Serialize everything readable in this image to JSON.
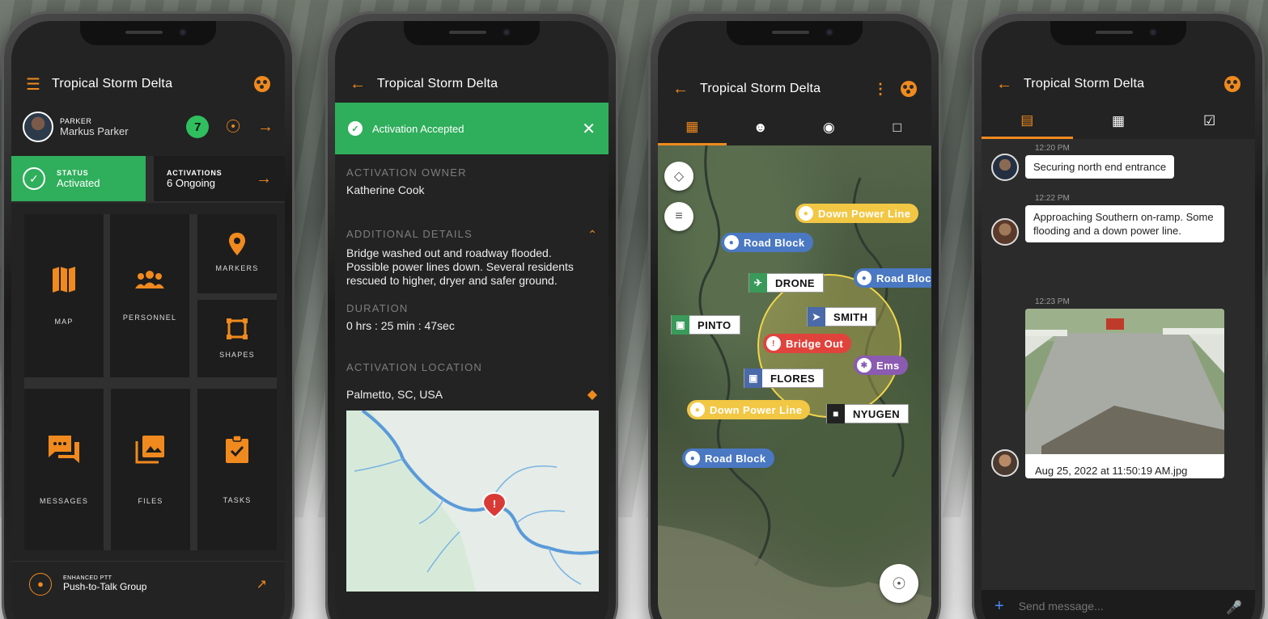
{
  "app": {
    "title": "Tropical Storm Delta",
    "colors": {
      "accent": "#f08a1e",
      "success": "#2fae5b",
      "dark_bg": "#232323"
    }
  },
  "dashboard": {
    "user_role": "PARKER",
    "user_name": "Markus Parker",
    "nav_badge": "7",
    "status": {
      "label": "STATUS",
      "value": "Activated"
    },
    "activations": {
      "label": "ACTIVATIONS",
      "value": "6 Ongoing"
    },
    "tiles": [
      {
        "label": "MAP",
        "icon": "map-icon"
      },
      {
        "label": "PERSONNEL",
        "icon": "people-icon"
      },
      {
        "label": "MARKERS",
        "icon": "marker-pin-icon"
      },
      {
        "label": "SHAPES",
        "icon": "shape-square-icon"
      },
      {
        "label": "MESSAGES",
        "icon": "chat-icon"
      },
      {
        "label": "FILES",
        "icon": "photo-library-icon"
      },
      {
        "label": "TASKS",
        "icon": "clipboard-check-icon"
      }
    ],
    "ptt": {
      "label": "ENHANCED PTT",
      "value": "Push-to-Talk Group"
    }
  },
  "activation": {
    "banner": "Activation Accepted",
    "owner_label": "ACTIVATION OWNER",
    "owner": "Katherine Cook",
    "details_label": "ADDITIONAL DETAILS",
    "details": "Bridge washed out and roadway flooded. Possible power lines down. Several residents rescued to higher, dryer and safer ground.",
    "duration_label": "DURATION",
    "duration": "0 hrs : 25 min : 47sec",
    "location_label": "ACTIVATION LOCATION",
    "location": "Palmetto, SC, USA"
  },
  "map_screen": {
    "markers": [
      {
        "label": "Down Power Line",
        "kind": "pill",
        "color": "#f2c744"
      },
      {
        "label": "Road Block",
        "kind": "pill",
        "color": "#4a78c2"
      },
      {
        "label": "DRONE",
        "kind": "box",
        "color": "#3a9a5a"
      },
      {
        "label": "Road Bloc",
        "kind": "pill",
        "color": "#4a78c2"
      },
      {
        "label": "PINTO",
        "kind": "box",
        "color": "#3a9a5a"
      },
      {
        "label": "SMITH",
        "kind": "box",
        "color": "#4a6aa8"
      },
      {
        "label": "Bridge Out",
        "kind": "pill",
        "color": "#e0433c"
      },
      {
        "label": "Ems",
        "kind": "pill",
        "color": "#8a5bb0"
      },
      {
        "label": "FLORES",
        "kind": "box",
        "color": "#4a6aa8"
      },
      {
        "label": "Down Power Line",
        "kind": "pill",
        "color": "#f2c744"
      },
      {
        "label": "NYUGEN",
        "kind": "box",
        "color": "#222222"
      },
      {
        "label": "Road Block",
        "kind": "pill",
        "color": "#4a78c2"
      }
    ]
  },
  "chat": {
    "messages": [
      {
        "time": "12:20 PM",
        "text": "Securing north end entrance"
      },
      {
        "time": "12:22 PM",
        "text": "Approaching Southern on-ramp. Some flooding and a down power line."
      },
      {
        "time": "12:23 PM",
        "text": "Aug 25, 2022 at 11:50:19 AM.jpg"
      }
    ],
    "placeholder": "Send message..."
  }
}
